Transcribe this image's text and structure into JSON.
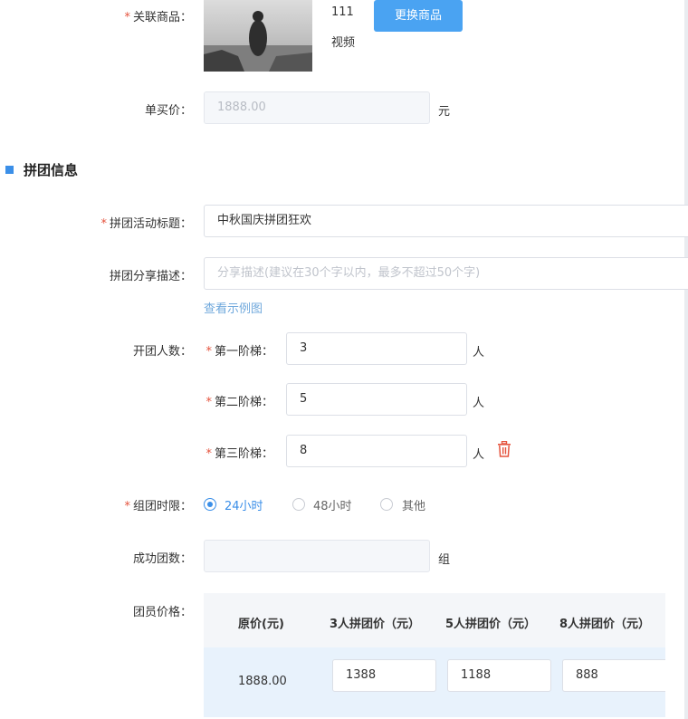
{
  "product": {
    "label": "关联商品：",
    "name": "111",
    "type": "视频",
    "change_button": "更换商品"
  },
  "single_price": {
    "label": "单买价：",
    "value": "1888.00",
    "unit": "元"
  },
  "section": {
    "title": "拼团信息"
  },
  "activity_title": {
    "label": "拼团活动标题：",
    "value": "中秋国庆拼团狂欢"
  },
  "share_desc": {
    "label": "拼团分享描述：",
    "placeholder": "分享描述(建议在30个字以内，最多不超过50个字)",
    "example_link": "查看示例图"
  },
  "group_size": {
    "label": "开团人数：",
    "tiers": [
      {
        "label": "第一阶梯：",
        "value": "3",
        "unit": "人"
      },
      {
        "label": "第二阶梯：",
        "value": "5",
        "unit": "人"
      },
      {
        "label": "第三阶梯：",
        "value": "8",
        "unit": "人"
      }
    ]
  },
  "time_limit": {
    "label": "组团时限：",
    "options": [
      "24小时",
      "48小时",
      "其他"
    ],
    "selected": "24小时"
  },
  "success_count": {
    "label": "成功团数：",
    "value": "",
    "unit": "组"
  },
  "member_price": {
    "label": "团员价格：",
    "columns": [
      "原价(元)",
      "3人拼团价（元）",
      "5人拼团价（元）",
      "8人拼团价（元）"
    ],
    "original": "1888.00",
    "prices": [
      "1388",
      "1188",
      "888"
    ]
  },
  "colors": {
    "accent": "#3b8fe8",
    "button": "#4aa3f2",
    "required": "#e5533d",
    "delete_icon": "#e5533d"
  }
}
